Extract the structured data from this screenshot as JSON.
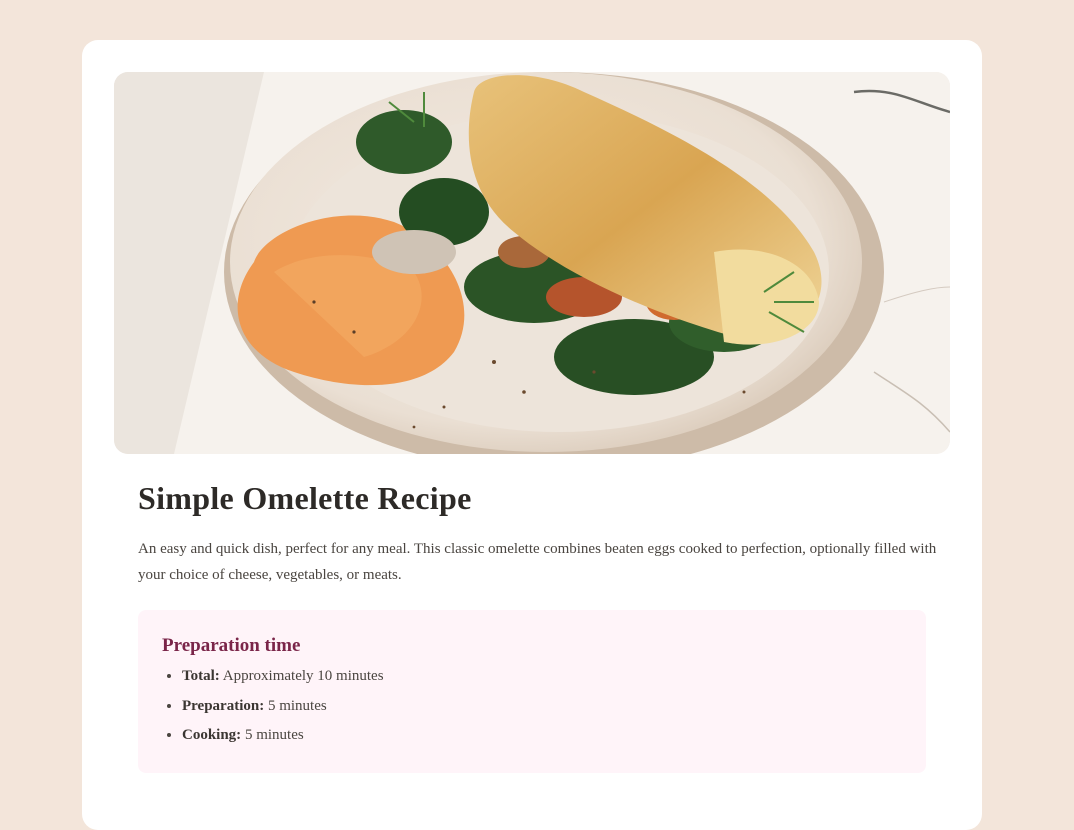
{
  "recipe": {
    "image_alt": "Omelette on a plate with spinach, mushrooms and a spread",
    "title": "Simple Omelette Recipe",
    "description": "An easy and quick dish, perfect for any meal. This classic omelette combines beaten eggs cooked to perfection, optionally filled with your choice of cheese, vegetables, or meats.",
    "prep": {
      "heading": "Preparation time",
      "items": [
        {
          "label": "Total:",
          "value": "Approximately 10 minutes"
        },
        {
          "label": "Preparation:",
          "value": "5 minutes"
        },
        {
          "label": "Cooking:",
          "value": "5 minutes"
        }
      ]
    }
  },
  "colors": {
    "page_bg": "#f3e5da",
    "card_bg": "#ffffff",
    "heading": "#2d2a27",
    "accent_heading": "#7a2549",
    "prep_bg": "#fff4f9",
    "body_text": "#4a4540"
  }
}
